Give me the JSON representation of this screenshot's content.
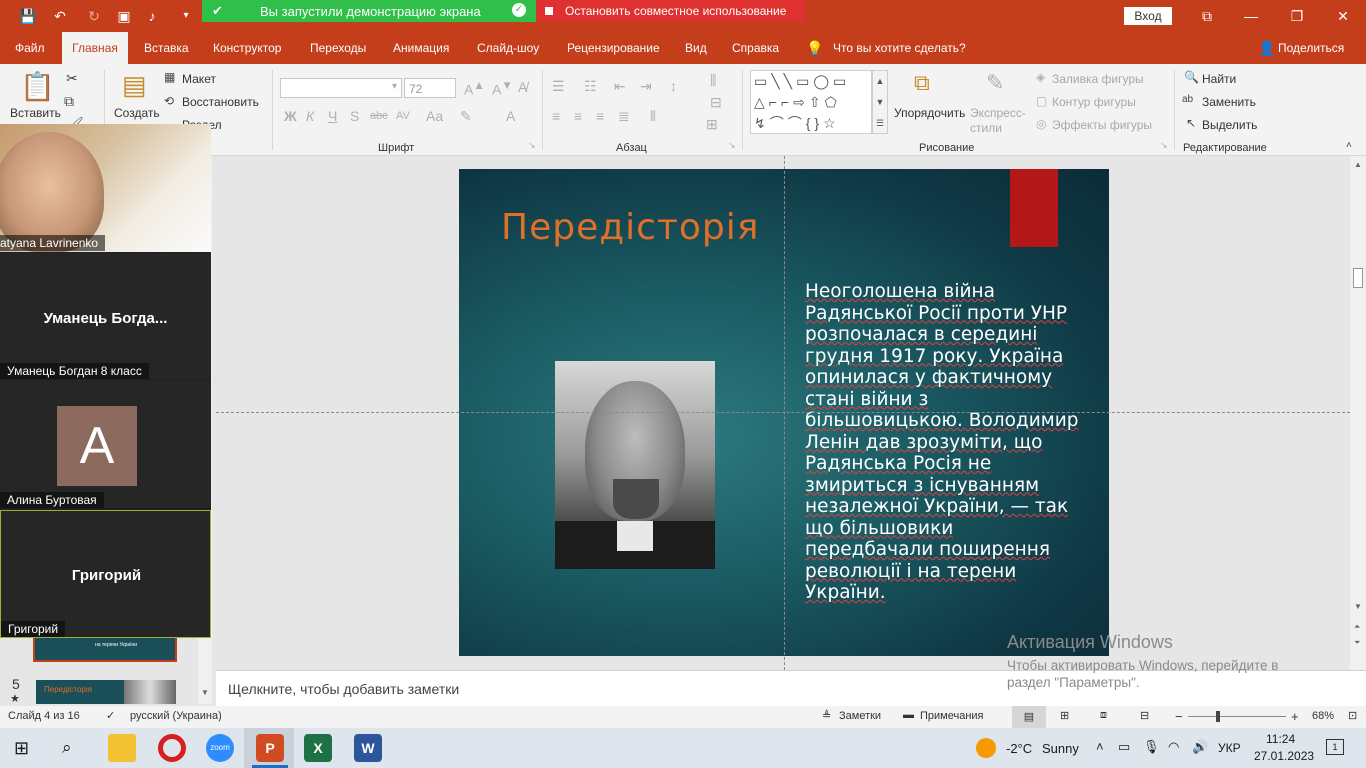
{
  "window": {
    "login_button": "Вход"
  },
  "share": {
    "notice": "Вы запустили демонстрацию экрана",
    "stop": "Остановить совместное использование"
  },
  "tabs": [
    "Файл",
    "Главная",
    "Вставка",
    "Конструктор",
    "Переходы",
    "Анимация",
    "Слайд-шоу",
    "Рецензирование",
    "Вид",
    "Справка"
  ],
  "tell_me": "Что вы хотите сделать?",
  "share_button": "Поделиться",
  "ribbon": {
    "paste": "Вставить",
    "create": "Создать",
    "layout": "Макет",
    "restore": "Восстановить",
    "section": "Раздел",
    "font_size": "72",
    "font_group": "Шрифт",
    "paragraph_group": "Абзац",
    "drawing_group": "Рисование",
    "arrange": "Упорядочить",
    "quick_styles": "Экспресс-стили",
    "fill": "Заливка фигуры",
    "outline": "Контур фигуры",
    "effects": "Эффекты фигуры",
    "editing_group": "Редактирование",
    "find": "Найти",
    "replace": "Заменить",
    "select": "Выделить",
    "font_buttons": [
      "Ж",
      "К",
      "Ч",
      "S",
      "abc",
      "AV",
      "Aa",
      "A"
    ]
  },
  "zoom_participants": [
    {
      "name": "atyana Lavrinenko",
      "display": "",
      "video": true
    },
    {
      "name": "Уманець Богдан 8 класс",
      "display": "Уманець  Богда..."
    },
    {
      "name": "Алина Буртовая",
      "avatar": "A"
    },
    {
      "name": "Григорий",
      "display": "Григорий"
    }
  ],
  "thumbnails": {
    "num": "5",
    "star": "★",
    "thumb5_title": "Передісторія",
    "thumb4_caption": "на терени України"
  },
  "slide": {
    "title": "Передісторія",
    "body": "  Неоголошена війна Радянської Росії проти УНР розпочалася в середині грудня 1917 року. Україна опинилася у фактичному стані війни з більшовицькою.  Володимир Ленін дав зрозуміти, що Радянська Росія не змириться з існуванням незалежної України, — так що більшовики передбачали поширення революції і на терени України."
  },
  "notes_placeholder": "Щелкните, чтобы добавить заметки",
  "activation": {
    "title": "Активация Windows",
    "line1": "Чтобы активировать Windows, перейдите в",
    "line2": "раздел \"Параметры\"."
  },
  "status": {
    "slide": "Слайд 4 из 16",
    "lang": "русский (Украина)",
    "notes": "Заметки",
    "comments": "Примечания",
    "zoom": "68%",
    "zoom_minus": "−",
    "zoom_plus": "+"
  },
  "taskbar": {
    "weather_temp": "-2°C",
    "weather_text": "Sunny",
    "lang": "УКР",
    "time": "11:24",
    "date": "27.01.2023",
    "badge": "1",
    "zoom_label": "zoom"
  },
  "colors": {
    "ppt_red": "#c43e1c",
    "slide_title": "#e07028",
    "share_green": "#2fbf4a",
    "share_red": "#e03131"
  }
}
